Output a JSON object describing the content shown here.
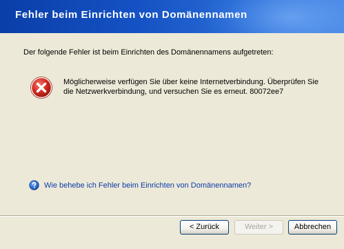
{
  "header": {
    "title": "Fehler beim Einrichten von Domänennamen"
  },
  "content": {
    "intro": "Der folgende Fehler ist beim Einrichten des Domänennamens aufgetreten:",
    "error_icon": "error-x-icon",
    "error_message": "Möglicherweise verfügen Sie über keine Internetverbindung. Überprüfen Sie die Netzwerkverbindung, und versuchen Sie es erneut. 80072ee7",
    "help_icon": "help-question-icon",
    "help_link": "Wie behebe ich Fehler beim Einrichten von Domänennamen?"
  },
  "buttons": {
    "back": "< Zurück",
    "next": "Weiter >",
    "cancel": "Abbrechen"
  },
  "colors": {
    "header_start": "#0a3ea8",
    "header_end": "#4a8ae6",
    "dialog_bg": "#ece9d8",
    "link": "#0b3ba8",
    "error_red": "#d12b1f"
  }
}
